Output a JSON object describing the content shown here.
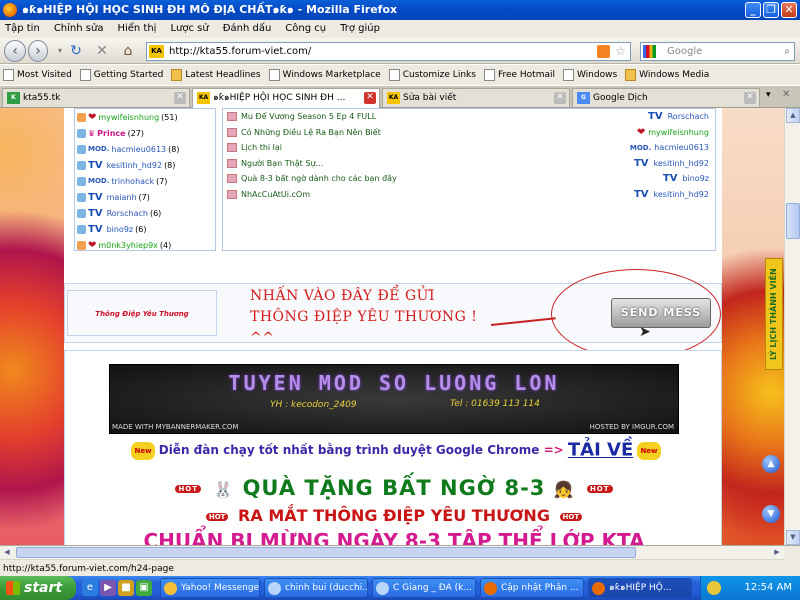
{
  "window": {
    "title": "๑ƙ๑HIỆP HỘI HỌC SINH ĐH MÔ ĐỊA CHẤT๑ƙ๑ - Mozilla Firefox"
  },
  "menu": [
    "Tập tin",
    "Chỉnh sửa",
    "Hiển thị",
    "Lược sử",
    "Đánh dấu",
    "Công cụ",
    "Trợ giúp"
  ],
  "nav": {
    "url": "http://kta55.forum-viet.com/",
    "search_placeholder": "Google"
  },
  "bookmarks": [
    "Most Visited",
    "Getting Started",
    "Latest Headlines",
    "Windows Marketplace",
    "Customize Links",
    "Free Hotmail",
    "Windows",
    "Windows Media"
  ],
  "tabs": [
    {
      "label": "kta55.tk"
    },
    {
      "label": "๑ƙ๑HIỆP HỘI HỌC SINH ĐH ..."
    },
    {
      "label": "Sửa bài viết"
    },
    {
      "label": "Google Dịch"
    }
  ],
  "users": [
    {
      "prefix": "",
      "name": "mywifeisnhung",
      "count": "(51)",
      "color": "#18a318"
    },
    {
      "prefix": "",
      "name": "Prince",
      "count": "(27)",
      "color": "#c71585"
    },
    {
      "prefix": "MOD.",
      "name": "hacmieu0613",
      "count": "(8)",
      "color": "#2855b8"
    },
    {
      "prefix": "TV",
      "name": "kesitinh_hd92",
      "count": "(8)",
      "color": "#2855b8"
    },
    {
      "prefix": "MOD.",
      "name": "trinhohack",
      "count": "(7)",
      "color": "#2855b8"
    },
    {
      "prefix": "TV",
      "name": "maianh",
      "count": "(7)",
      "color": "#2855b8"
    },
    {
      "prefix": "TV",
      "name": "Rorschach",
      "count": "(6)",
      "color": "#2855b8"
    },
    {
      "prefix": "TV",
      "name": "bino9z",
      "count": "(6)",
      "color": "#2855b8"
    },
    {
      "prefix": "",
      "name": "m0nk3yhiep9x",
      "count": "(4)",
      "color": "#18a318"
    }
  ],
  "topics": [
    {
      "title": "Mu Đế Vương Season 5 Ep 4 FULL",
      "prefix": "TV",
      "author": "Rorschach",
      "color": "#2855b8"
    },
    {
      "title": "Có Những Điều Lệ Ra Bạn Nên Biết",
      "prefix": "",
      "author": "mywifeisnhung",
      "color": "#18a318"
    },
    {
      "title": "Lịch thi lại",
      "prefix": "MOD.",
      "author": "hacmieu0613",
      "color": "#2855b8"
    },
    {
      "title": "Người Bạn Thật Sự...",
      "prefix": "TV",
      "author": "kesitinh_hd92",
      "color": "#2855b8"
    },
    {
      "title": "Quà 8-3 bất ngờ dành cho các bạn đây",
      "prefix": "TV",
      "author": "bino9z",
      "color": "#2855b8"
    },
    {
      "title": "NhAcCuAtUi.cOm",
      "prefix": "TV",
      "author": "kesitinh_hd92",
      "color": "#2855b8"
    }
  ],
  "message": {
    "logo": "Thông Điệp Yêu Thương",
    "line1": "NHẤN VÀO ĐÂY ĐỂ GỬI",
    "line2": "THÔNG ĐIỆP YÊU THƯƠNG !",
    "line3": "^^",
    "button": "SEND MESS"
  },
  "banner": {
    "title": "TUYEN MOD SO LUONG LON",
    "credit": "YH : kecodon_2409",
    "phone": "Tel : 01639 113 114",
    "made": "MADE WITH MYBANNERMAKER.COM",
    "hosted": "HOSTED BY IMGUR.COM"
  },
  "promo": {
    "new": "New",
    "chrome": "Diễn đàn chạy tốt nhất bằng trình duyệt Google Chrome",
    "arrow": "=>",
    "taive": "TẢI VỀ",
    "hot": "HOT",
    "qua": "QUÀ TẶNG BẤT NGỜ 8-3",
    "ramat": "RA MẮT THÔNG ĐIỆP YÊU THƯƠNG",
    "chuan": "CHUẨN BỊ MỪNG NGÀY 8-3 TẬP THỂ LỚP KTA"
  },
  "sidetab": "LÝ LỊCH THÀNH VIÊN",
  "status": {
    "url": "http://kta55.forum-viet.com/h24-page"
  },
  "taskbar": {
    "start": "start",
    "items": [
      "Yahoo! Messenger",
      "chinh bui (ducchi...",
      "C Giang _ ĐA (k...",
      "Cập nhật Phân ...",
      "๑ƙ๑HIỆP HỘ..."
    ],
    "clock": "12:54 AM"
  }
}
